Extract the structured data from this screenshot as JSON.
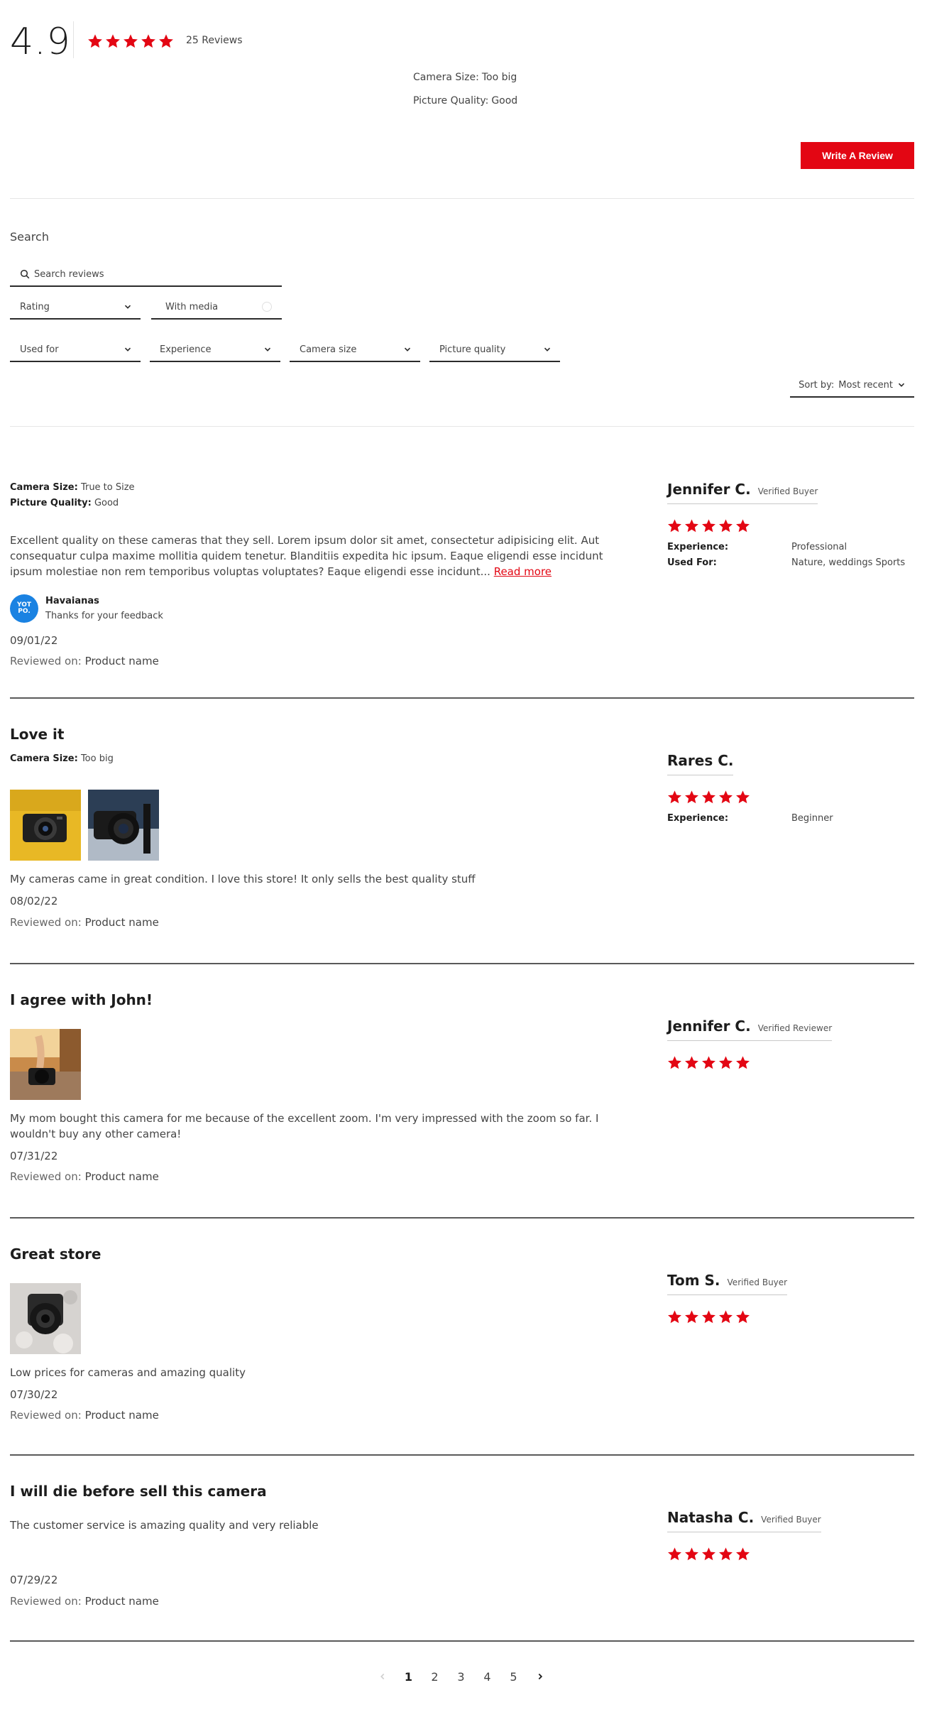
{
  "header": {
    "average_rating": "4.9",
    "rating_value": 4.9,
    "review_count": "25 Reviews",
    "summary": [
      {
        "label": "Camera Size:",
        "value": "Too big"
      },
      {
        "label": "Picture Quality:",
        "value": "Good"
      }
    ],
    "write_review_label": "Write A Review"
  },
  "filters": {
    "search_label": "Search",
    "search_placeholder": "Search reviews",
    "rating_label": "Rating",
    "with_media_label": "With media",
    "used_for_label": "Used for",
    "experience_label": "Experience",
    "camera_size_label": "Camera size",
    "picture_quality_label": "Picture quality",
    "sort_prefix": "Sort by:",
    "sort_value": "Most recent"
  },
  "reviews": [
    {
      "title": "",
      "attributes": [
        {
          "label": "Camera Size:",
          "value": "True to Size"
        },
        {
          "label": "Picture Quality:",
          "value": "Good"
        }
      ],
      "body": "Excellent quality on these cameras that they sell. Lorem ipsum dolor sit amet, consectetur adipisicing elit. Aut consequatur culpa maxime mollitia quidem tenetur. Blanditiis expedita hic ipsum. Eaque eligendi esse incidunt ipsum molestiae non rem temporibus voluptas voluptates? Eaque eligendi esse incidunt...",
      "read_more": "Read more",
      "reply": {
        "logo_text": "YOT PO.",
        "name": "Havaianas",
        "text": "Thanks for your feedback"
      },
      "date": "09/01/22",
      "reviewed_on_label": "Reviewed on:",
      "product": "Product name",
      "author": "Jennifer C.",
      "badge": "Verified Buyer",
      "rating": 5,
      "info": [
        {
          "label": "Experience:",
          "value": "Professional"
        },
        {
          "label": "Used For:",
          "value": "Nature, weddings Sports"
        }
      ]
    },
    {
      "title": "Love it",
      "attributes": [
        {
          "label": "Camera Size:",
          "value": "Too big"
        }
      ],
      "images": [
        "compact-camera-photo",
        "dslr-camera-photo"
      ],
      "body": "My cameras came in great condition. I love this store! It only sells the best quality stuff",
      "date": "08/02/22",
      "reviewed_on_label": "Reviewed on:",
      "product": "Product name",
      "author": "Rares C.",
      "badge": "",
      "rating": 5,
      "info": [
        {
          "label": "Experience:",
          "value": "Beginner"
        }
      ]
    },
    {
      "title": "I agree with John!",
      "images": [
        "hand-holding-camera-photo"
      ],
      "body": "My mom bought this camera for me because of the excellent zoom. I'm very impressed with the zoom so far. I wouldn't buy any other camera!",
      "date": "07/31/22",
      "reviewed_on_label": "Reviewed on:",
      "product": "Product name",
      "author": "Jennifer C.",
      "badge": "Verified Reviewer",
      "rating": 5
    },
    {
      "title": "Great store",
      "images": [
        "camera-on-lace-photo"
      ],
      "body": "Low prices for cameras and amazing quality",
      "date": "07/30/22",
      "reviewed_on_label": "Reviewed on:",
      "product": "Product name",
      "author": "Tom S.",
      "badge": "Verified Buyer",
      "rating": 5
    },
    {
      "title": "I will die before sell this camera",
      "body": "The customer service is amazing quality and very reliable",
      "date": "07/29/22",
      "reviewed_on_label": "Reviewed on:",
      "product": "Product name",
      "author": "Natasha C.",
      "badge": "Verified Buyer",
      "rating": 5
    }
  ],
  "pagination": {
    "pages": [
      "1",
      "2",
      "3",
      "4",
      "5"
    ],
    "current": "1"
  },
  "colors": {
    "accent": "#e30613",
    "text": "#2b2b2b",
    "divider": "#5a5a5a",
    "reply_logo": "#1a82e2"
  },
  "icons": [
    "star-icon",
    "search-icon",
    "chevron-down-icon",
    "chevron-left-icon",
    "chevron-right-icon"
  ]
}
